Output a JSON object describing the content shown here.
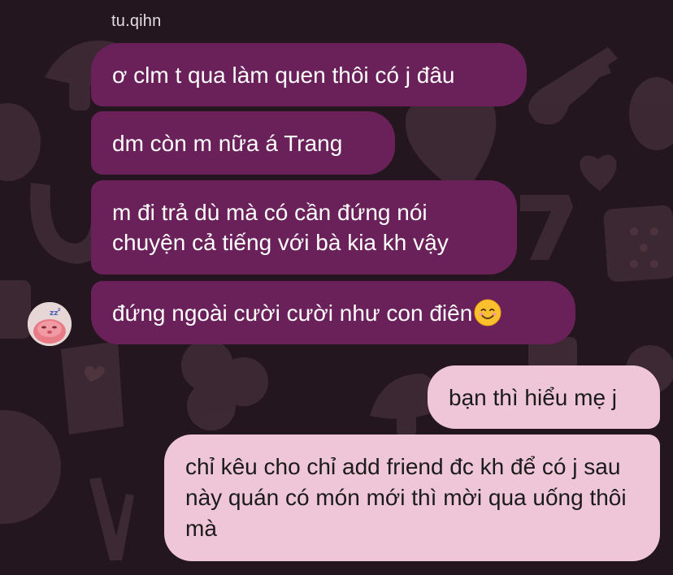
{
  "chat": {
    "sender_name": "tu.qihn",
    "messages": [
      {
        "direction": "incoming",
        "text": "ơ clm t qua làm quen thôi có j đâu"
      },
      {
        "direction": "incoming",
        "text": "dm còn m nữa á Trang"
      },
      {
        "direction": "incoming",
        "text": "m đi trả dù mà có cần đứng nói chuyện cả tiếng với bà kia kh vậy"
      },
      {
        "direction": "incoming",
        "text": "đứng ngoài cười cười như con điên",
        "emoji": "smiling-face-emoji"
      },
      {
        "direction": "outgoing",
        "text": "bạn thì hiểu mẹ j"
      },
      {
        "direction": "outgoing",
        "text": "chỉ kêu cho chỉ add friend đc kh để có j sau này quán có món mới thì mời qua uống thôi mà"
      }
    ]
  },
  "avatar": {
    "icon": "sleeping-pink-character-avatar"
  },
  "colors": {
    "background": "#24161e",
    "incoming_bubble": "#6a2059",
    "outgoing_bubble": "#efc6d7",
    "incoming_text": "#ffffff",
    "outgoing_text": "#1b1b1b"
  }
}
